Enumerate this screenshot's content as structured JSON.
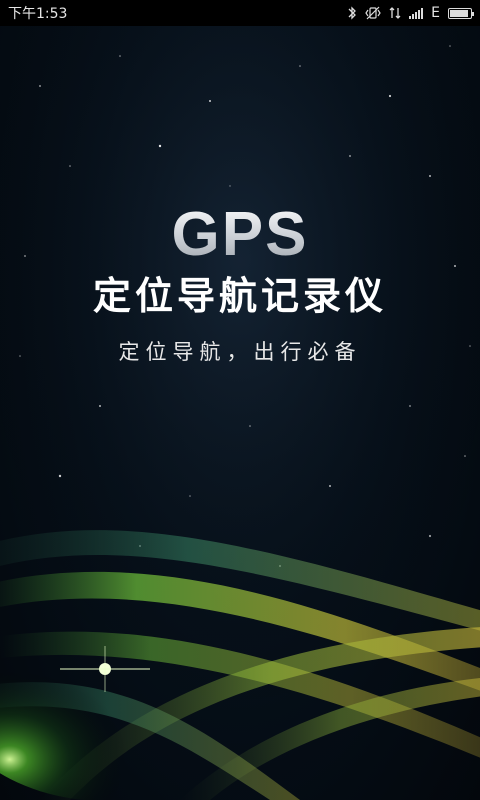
{
  "status_bar": {
    "time": "下午1:53",
    "network_type": "E",
    "icons": [
      "bluetooth-icon",
      "vibrate-icon",
      "data-arrows-icon",
      "signal-icon",
      "network-type-label",
      "battery-icon"
    ],
    "battery_level": 0.9
  },
  "splash": {
    "logo_text": "GPS",
    "title": "定位导航记录仪",
    "subtitle": "定位导航，出行必备"
  },
  "colors": {
    "background": "#050a10",
    "light_green": "#7fd34a",
    "light_yellow": "#d8c23a",
    "status_bar": "#000000"
  }
}
